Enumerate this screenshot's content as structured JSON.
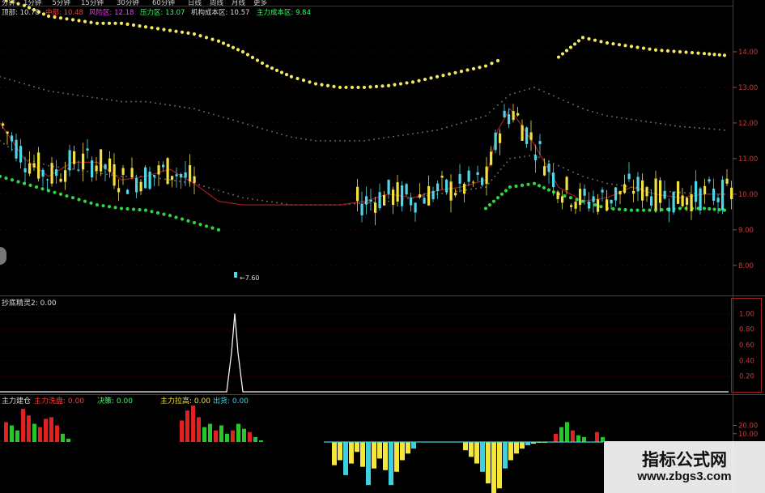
{
  "header": {
    "periods": [
      "分钟",
      "1分钟",
      "5分钟",
      "15分钟",
      "30分钟",
      "60分钟",
      "日线",
      "周线",
      "月线",
      "更多"
    ],
    "indicators": [
      {
        "label": "顶部",
        "value": "10.78",
        "color": "#dcdcdc"
      },
      {
        "label": "中部",
        "value": "10.48",
        "color": "#ff3b3b"
      },
      {
        "label": "风险区",
        "value": "12.18",
        "color": "#ff33ff"
      },
      {
        "label": "压力区",
        "value": "13.07",
        "color": "#33ff66"
      },
      {
        "label": "机构成本区",
        "value": "10.57",
        "color": "#dcdcdc"
      },
      {
        "label": "主力成本区",
        "value": "9.84",
        "color": "#33ff66"
      }
    ]
  },
  "colors": {
    "yellow_band": "#f2e85a",
    "green_band": "#2fd640",
    "red_line": "#b01e1e",
    "grey_band": "#7b7b7b",
    "candle_up": "#f0e040",
    "candle_down": "#4fd6e6",
    "axis_red": "#c43b3b",
    "bar_red": "#e02222",
    "bar_green": "#27c72b",
    "bar_yellow": "#f5e63a",
    "bar_cyan": "#3fd0e0"
  },
  "price_panel": {
    "ticks": [
      "14.00",
      "13.00",
      "12.00",
      "11.00",
      "10.00",
      "9.00",
      "8.00"
    ],
    "low_marker": "←7.60"
  },
  "mid_panel": {
    "title": "抄底精灵2: 0.00",
    "ticks": [
      "1.00",
      "0.80",
      "0.60",
      "0.40",
      "0.20"
    ]
  },
  "bottom_panel": {
    "labels": [
      {
        "text": "主力建仓",
        "color": "#dcdcdc"
      },
      {
        "text": "主力洗盘: 0.00",
        "color": "#ff3b3b"
      },
      {
        "text": "决策: 0.00",
        "color": "#33ff66"
      },
      {
        "text": "主力拉高: 0.00",
        "color": "#f5e63a"
      },
      {
        "text": "出货: 0.00",
        "color": "#3fd0e0"
      }
    ],
    "ticks": [
      "20.00",
      "10.00"
    ]
  },
  "watermark": {
    "title": "指标公式网",
    "url": "www.zbgs3.com"
  },
  "chart_data": [
    {
      "type": "line",
      "title": "",
      "ylim": [
        7.2,
        15.0
      ],
      "x": [
        0,
        30,
        60,
        90,
        120,
        150,
        180,
        210,
        240,
        270,
        300,
        330,
        360,
        390,
        420,
        450,
        480,
        510,
        540,
        570,
        600,
        615,
        630,
        660,
        690,
        720,
        750,
        780,
        810,
        840,
        870,
        895
      ],
      "series": [
        {
          "name": "",
          "values": [
            15.5,
            15.3,
            15.0,
            14.9,
            14.8,
            14.8,
            14.7,
            14.6,
            14.5,
            14.3,
            14.0,
            13.6,
            13.3,
            13.1,
            13.0,
            13.0,
            13.05,
            13.15,
            13.3,
            13.45,
            13.6,
            13.75,
            null,
            null,
            13.85,
            14.4,
            14.25,
            14.15,
            14.05,
            14.0,
            13.95,
            13.9
          ]
        },
        {
          "name": "",
          "values": [
            13.3,
            13.1,
            12.9,
            12.8,
            12.7,
            12.6,
            12.6,
            12.5,
            12.4,
            12.2,
            12.0,
            11.8,
            11.6,
            11.5,
            11.5,
            11.5,
            11.6,
            11.7,
            11.8,
            12.0,
            12.2,
            12.5,
            12.8,
            13.0,
            12.7,
            12.4,
            12.2,
            12.1,
            12.0,
            11.9,
            11.85,
            11.8
          ]
        },
        {
          "name": "",
          "values": [
            11.5,
            11.0,
            10.8,
            10.7,
            10.6,
            10.5,
            10.5,
            10.4,
            10.3,
            10.1,
            9.9,
            9.8,
            9.7,
            9.7,
            9.7,
            9.75,
            9.8,
            9.9,
            10.0,
            10.1,
            10.2,
            10.6,
            11.0,
            11.1,
            10.8,
            10.5,
            10.3,
            10.2,
            10.1,
            10.05,
            10.0,
            10.0
          ]
        },
        {
          "name": "",
          "values": [
            12.0,
            11.0,
            10.5,
            10.9,
            10.9,
            10.4,
            10.5,
            10.7,
            10.3,
            9.8,
            9.7,
            9.7,
            9.7,
            9.7,
            9.7,
            9.8,
            10.0,
            9.9,
            10.1,
            10.2,
            10.4,
            11.8,
            12.4,
            11.4,
            10.2,
            9.8,
            9.9,
            10.2,
            10.0,
            9.9,
            10.0,
            10.0
          ]
        },
        {
          "name": "",
          "values": [
            10.5,
            10.3,
            10.1,
            9.9,
            9.7,
            9.6,
            9.55,
            9.4,
            9.2,
            9.0,
            null,
            null,
            null,
            null,
            null,
            null,
            null,
            null,
            null,
            null,
            9.6,
            9.9,
            10.2,
            10.3,
            10.0,
            9.8,
            9.6,
            9.55,
            9.55,
            9.6,
            9.6,
            9.55
          ]
        }
      ]
    },
    {
      "type": "line",
      "title": "",
      "ylim": [
        0,
        1.2
      ],
      "x": [
        0,
        280,
        286,
        290,
        294,
        300,
        900
      ],
      "series": [
        {
          "name": "",
          "values": [
            0,
            0,
            0.5,
            1.0,
            0.5,
            0,
            0
          ]
        }
      ]
    },
    {
      "type": "bar",
      "title": "",
      "ylim": [
        -60,
        45
      ],
      "x": [
        5,
        12,
        19,
        26,
        33,
        40,
        47,
        54,
        61,
        68,
        75,
        82,
        222,
        229,
        236,
        243,
        250,
        257,
        264,
        271,
        278,
        285,
        292,
        299,
        306,
        313,
        320,
        410,
        417,
        424,
        431,
        438,
        445,
        452,
        459,
        466,
        473,
        480,
        487,
        494,
        501,
        508,
        572,
        579,
        586,
        593,
        600,
        607,
        614,
        621,
        628,
        635,
        642,
        649,
        656,
        663,
        670,
        684,
        691,
        698,
        705,
        712,
        719,
        735,
        742
      ],
      "series": [
        {
          "name": "",
          "values": [
            24,
            20,
            14,
            40,
            32,
            22,
            18,
            28,
            30,
            20,
            10,
            4,
            26,
            38,
            44,
            30,
            18,
            22,
            14,
            20,
            10,
            14,
            22,
            16,
            12,
            6,
            2,
            -28,
            -22,
            -40,
            -26,
            -12,
            -30,
            -52,
            -32,
            -20,
            -34,
            -52,
            -36,
            -22,
            -14,
            -8,
            -10,
            -18,
            -26,
            -36,
            -50,
            -62,
            -56,
            -32,
            -22,
            -14,
            -8,
            -4,
            -2,
            -1,
            -1,
            10,
            18,
            24,
            14,
            8,
            6,
            12,
            6
          ]
        }
      ]
    }
  ]
}
